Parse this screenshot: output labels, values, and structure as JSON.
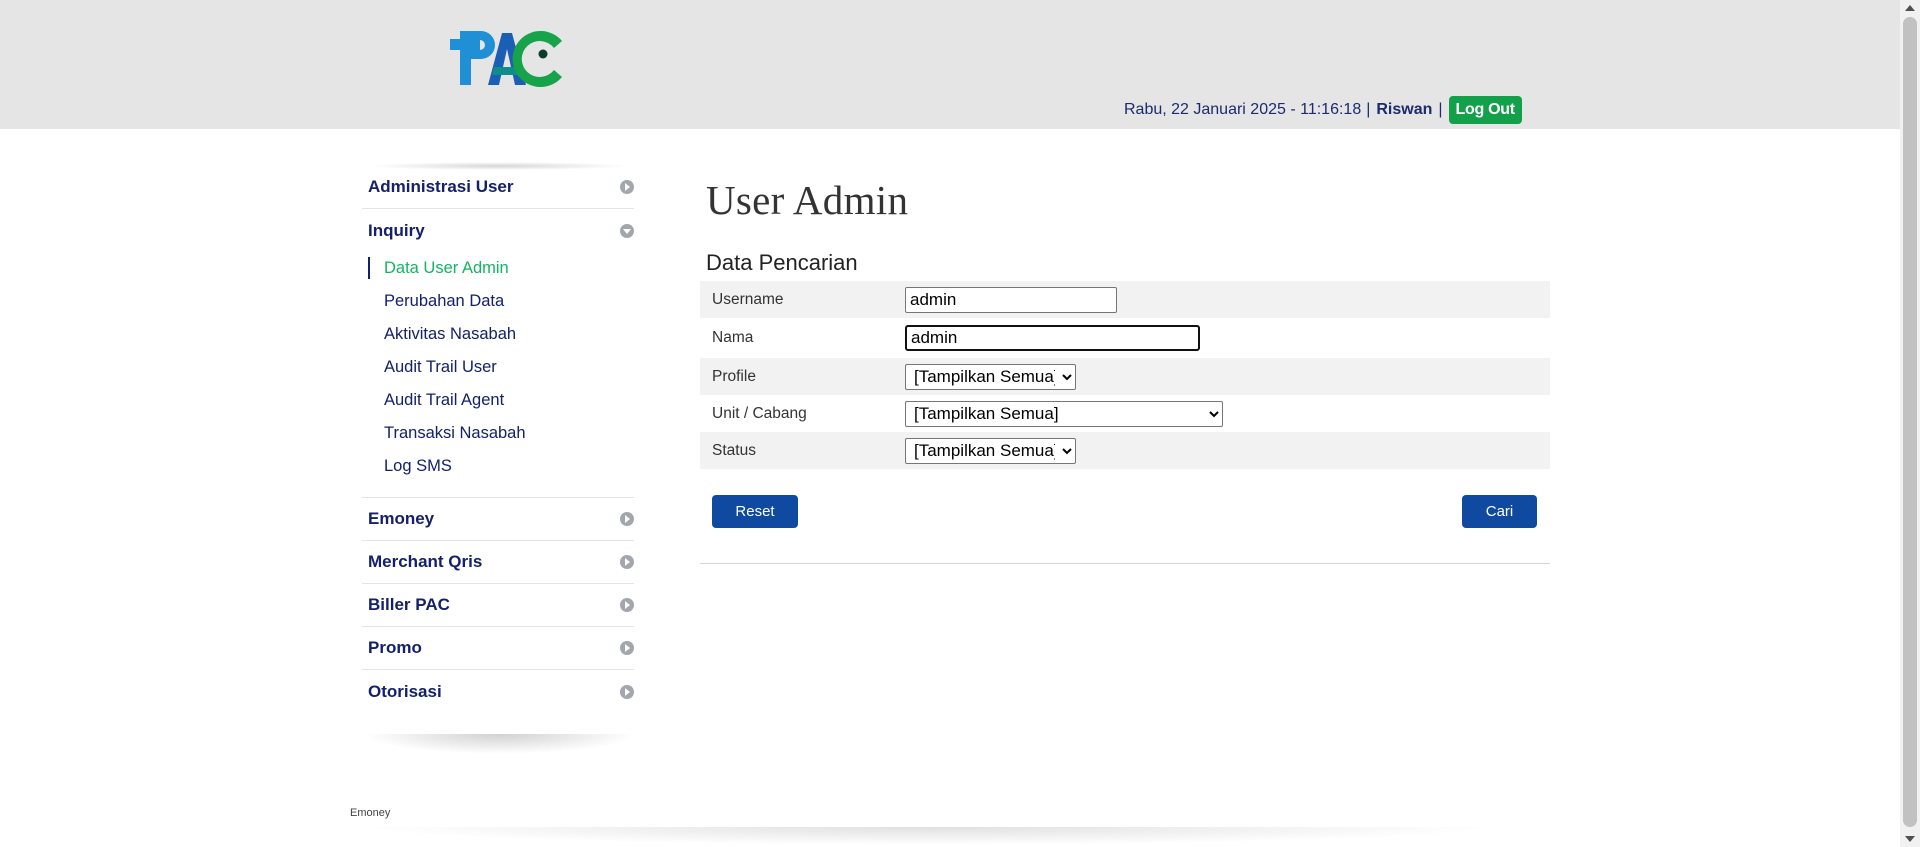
{
  "header": {
    "logo_text": "PAC",
    "datetime": "Rabu, 22 Januari 2025 - 11:16:18",
    "separator": "|",
    "username": "Riswan",
    "logout_label": "Log Out"
  },
  "sidebar": {
    "sections": [
      {
        "label": "Administrasi User",
        "icon": "chevron-right-icon"
      },
      {
        "label": "Inquiry",
        "icon": "chevron-down-icon",
        "expanded": true
      },
      {
        "label": "Emoney",
        "icon": "chevron-right-icon"
      },
      {
        "label": "Merchant Qris",
        "icon": "chevron-right-icon"
      },
      {
        "label": "Biller PAC",
        "icon": "chevron-right-icon"
      },
      {
        "label": "Promo",
        "icon": "chevron-right-icon"
      },
      {
        "label": "Otorisasi",
        "icon": "chevron-right-icon"
      }
    ],
    "inquiry_items": [
      {
        "label": "Data User Admin",
        "active": true
      },
      {
        "label": "Perubahan Data"
      },
      {
        "label": "Aktivitas Nasabah"
      },
      {
        "label": "Audit Trail User"
      },
      {
        "label": "Audit Trail Agent"
      },
      {
        "label": "Transaksi Nasabah"
      },
      {
        "label": "Log SMS"
      }
    ]
  },
  "main": {
    "title": "User Admin",
    "section_title": "Data Pencarian",
    "form": {
      "username_label": "Username",
      "username_value": "admin",
      "nama_label": "Nama",
      "nama_value": "admin",
      "profile_label": "Profile",
      "profile_value": "[Tampilkan Semua]",
      "unit_label": "Unit / Cabang",
      "unit_value": "[Tampilkan Semua]",
      "status_label": "Status",
      "status_value": "[Tampilkan Semua]"
    },
    "reset_label": "Reset",
    "cari_label": "Cari"
  },
  "footer": {
    "text": "Emoney"
  },
  "colors": {
    "header_bg": "#e6e5e6",
    "menu_text": "#14206b",
    "active_item": "#12b561",
    "logout_bg": "#12a04a",
    "button_bg": "#0f4aa0",
    "row_alt_bg": "#f2f2f2"
  }
}
